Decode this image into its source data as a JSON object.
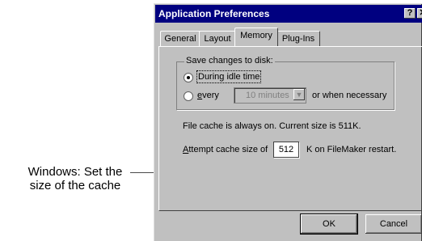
{
  "callout": {
    "line1": "Windows: Set the",
    "line2": "size of the cache"
  },
  "window": {
    "title": "Application Preferences",
    "help_label": "?",
    "close_label": "✕"
  },
  "tabs": [
    {
      "label": "General"
    },
    {
      "label": "Layout"
    },
    {
      "label": "Memory"
    },
    {
      "label": "Plug-Ins"
    }
  ],
  "save_group": {
    "label": "Save changes to disk:",
    "option_idle": "During idle time",
    "option_every_prefix": "e",
    "option_every_rest": "very",
    "interval_value": "10 minutes",
    "interval_suffix": "or when necessary",
    "selected": "During idle time"
  },
  "cache_info": "File cache is always on.  Current size is 511K.",
  "attempt": {
    "prefix_mnemonic": "A",
    "prefix_rest": "ttempt cache size of",
    "value": "512",
    "suffix": "K on FileMaker restart."
  },
  "buttons": {
    "ok": "OK",
    "cancel": "Cancel"
  },
  "icons": {
    "help": "help-icon",
    "close": "close-icon",
    "dropdown": "chevron-down-icon"
  }
}
